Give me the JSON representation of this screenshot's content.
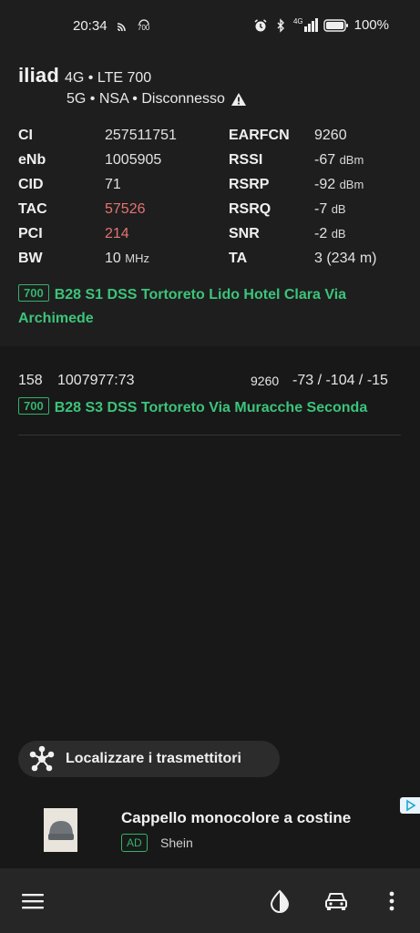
{
  "status_bar": {
    "time": "20:34",
    "left_icons": [
      "cast-icon",
      "hotspot-700-icon"
    ],
    "hotspot_label": "700",
    "right_icons": [
      "alarm-icon",
      "bluetooth-icon",
      "signal-4g-icon",
      "battery-icon"
    ],
    "network_label": "4G",
    "battery": "100%"
  },
  "cell": {
    "operator": "iliad",
    "tech_line": "4G • LTE 700",
    "nr_line": "5G • NSA • Disconnesso",
    "rows": [
      {
        "k1": "CI",
        "v1": "257511751",
        "k2": "EARFCN",
        "v2": "9260",
        "u2": ""
      },
      {
        "k1": "eNb",
        "v1": "1005905",
        "k2": "RSSI",
        "v2": "-67",
        "u2": "dBm"
      },
      {
        "k1": "CID",
        "v1": "71",
        "k2": "RSRP",
        "v2": "-92",
        "u2": "dBm"
      },
      {
        "k1": "TAC",
        "v1": "57526",
        "k2": "RSRQ",
        "v2": "-7",
        "u2": "dB"
      },
      {
        "k1": "PCI",
        "v1": "214",
        "k2": "SNR",
        "v2": "-2",
        "u2": "dB"
      },
      {
        "k1": "BW",
        "v1": "10",
        "u1": "MHz",
        "k2": "TA",
        "v2": "3 (234 m)",
        "u2": ""
      }
    ],
    "band": "700",
    "site": "B28 S1 DSS Tortoreto Lido Hotel Clara Via Archimede"
  },
  "neighbour": {
    "pci": "158",
    "ci": "1007977:73",
    "earfcn": "9260",
    "signal": "-73 / -104 / -15",
    "band": "700",
    "site": "B28 S3 DSS Tortoreto Via Muracche Seconda"
  },
  "locate_button": {
    "label": "Localizzare i trasmettitori",
    "icon": "network-nodes-icon"
  },
  "ad": {
    "title": "Cappello monocolore a costine",
    "badge": "AD",
    "advertiser": "Shein",
    "choices_icon": "ad-choices-icon"
  },
  "bottom_bar": {
    "icons": [
      "menu-icon",
      "theme-contrast-icon",
      "car-icon",
      "more-vert-icon"
    ]
  },
  "colors": {
    "accent_green": "#3cc47a",
    "warning_red": "#e57373",
    "background": "#181818",
    "card": "#1e1e1e"
  }
}
